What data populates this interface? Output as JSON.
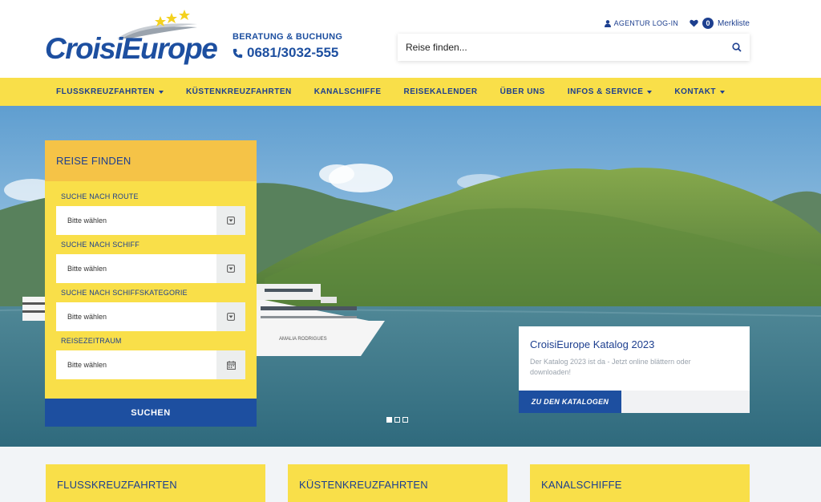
{
  "logo": {
    "text": "CroisiEurope"
  },
  "contact": {
    "label": "BERATUNG & BUCHUNG",
    "phone": "0681/3032-555"
  },
  "top_links": {
    "agent_login": "AGENTUR LOG-IN",
    "wishlist_count": "0",
    "wishlist_label": "Merkliste"
  },
  "search": {
    "placeholder": "Reise finden..."
  },
  "nav": {
    "items": [
      {
        "label": "FLUSSKREUZFAHRTEN",
        "dropdown": true
      },
      {
        "label": "KÜSTENKREUZFAHRTEN",
        "dropdown": false
      },
      {
        "label": "KANALSCHIFFE",
        "dropdown": false
      },
      {
        "label": "REISEKALENDER",
        "dropdown": false
      },
      {
        "label": "ÜBER UNS",
        "dropdown": false
      },
      {
        "label": "INFOS & SERVICE",
        "dropdown": true
      },
      {
        "label": "KONTAKT",
        "dropdown": true
      }
    ]
  },
  "panel": {
    "title": "REISE FINDEN",
    "fields": [
      {
        "label": "SUCHE NACH ROUTE",
        "value": "Bitte wählen",
        "icon": "chevron-down-icon"
      },
      {
        "label": "SUCHE NACH SCHIFF",
        "value": "Bitte wählen",
        "icon": "chevron-down-icon"
      },
      {
        "label": "SUCHE NACH SCHIFFSKATEGORIE",
        "value": "Bitte wählen",
        "icon": "chevron-down-icon"
      },
      {
        "label": "REISEZEITRAUM",
        "value": "Bitte wählen",
        "icon": "calendar-icon"
      }
    ],
    "submit_label": "SUCHEN"
  },
  "hero": {
    "ship_name": "AMALIA RODRIGUES",
    "slides": 3,
    "active_slide": 1
  },
  "card": {
    "title": "CroisiEurope Katalog 2023",
    "text": "Der Katalog 2023 ist da - Jetzt online blättern oder downloaden!",
    "button_label": "ZU DEN KATALOGEN"
  },
  "tiles": [
    {
      "label": "FLUSSKREUZFAHRTEN"
    },
    {
      "label": "KÜSTENKREUZFAHRTEN"
    },
    {
      "label": "KANALSCHIFFE"
    }
  ],
  "colors": {
    "brand_blue": "#1d4fa0",
    "yellow": "#f9df49",
    "orange_yellow": "#f5c347"
  }
}
